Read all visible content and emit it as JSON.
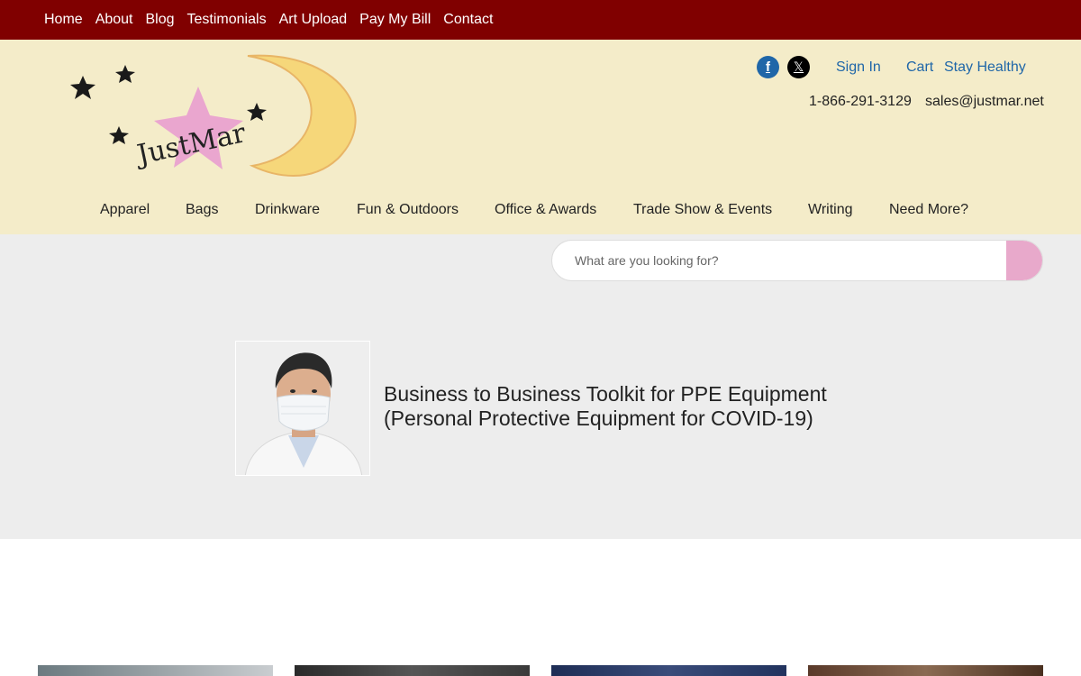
{
  "topnav": {
    "items": [
      "Home",
      "About",
      "Blog",
      "Testimonials",
      "Art Upload",
      "Pay My Bill",
      "Contact"
    ]
  },
  "header": {
    "logo_text": "JustMar",
    "social": {
      "facebook_glyph": "f",
      "x_glyph": "𝕏"
    },
    "util_links": {
      "sign_in": "Sign In",
      "cart": "Cart",
      "stay_healthy": "Stay Healthy"
    },
    "phone": "1-866-291-3129",
    "email": "sales@justmar.net"
  },
  "categories": [
    "Apparel",
    "Bags",
    "Drinkware",
    "Fun & Outdoors",
    "Office & Awards",
    "Trade Show & Events",
    "Writing",
    "Need More?"
  ],
  "search": {
    "placeholder": "What are you looking for?"
  },
  "hero": {
    "title_line1": "Business to Business Toolkit for PPE Equipment",
    "title_line2": "(Personal Protective Equipment for COVID-19)"
  },
  "colors": {
    "topbar": "#800000",
    "header_bg": "#f4ecc9",
    "link_blue": "#1f66a8",
    "search_button": "#e8a9cb",
    "band_bg": "#ededed"
  }
}
